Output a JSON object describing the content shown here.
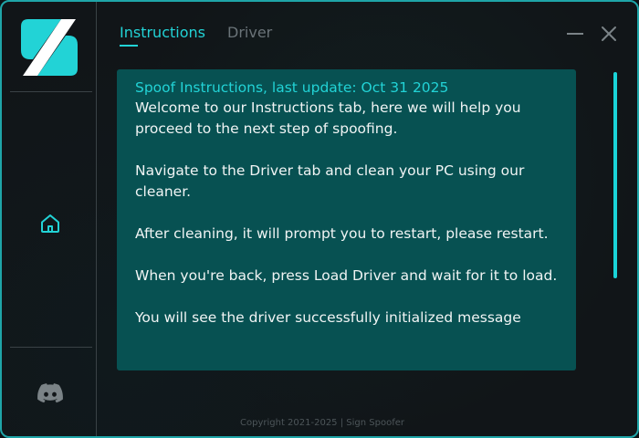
{
  "app": {
    "logo_icon": "sign-spoofer-logo",
    "accent_color": "#22d3d6",
    "panel_color": "#075152"
  },
  "tabs": [
    {
      "label": "Instructions",
      "active": true
    },
    {
      "label": "Driver",
      "active": false
    }
  ],
  "sidebar": {
    "items": [
      {
        "icon": "home-icon"
      },
      {
        "icon": "discord-icon"
      }
    ]
  },
  "window_controls": {
    "minimize_icon": "minimize-icon",
    "close_icon": "close-icon"
  },
  "panel": {
    "title": "Spoof Instructions, last update: Oct 31 2025",
    "paragraphs": [
      "Welcome to our Instructions tab, here we will help you proceed to the next step of spoofing.",
      "Navigate to the Driver tab and clean your PC using our cleaner.",
      "After cleaning, it will prompt you to restart, please restart.",
      "When you're back, press Load Driver and wait for it to load.",
      "You will see the driver successfully initialized message"
    ]
  },
  "footer": {
    "text": "Copyright 2021-2025 | Sign Spoofer"
  }
}
